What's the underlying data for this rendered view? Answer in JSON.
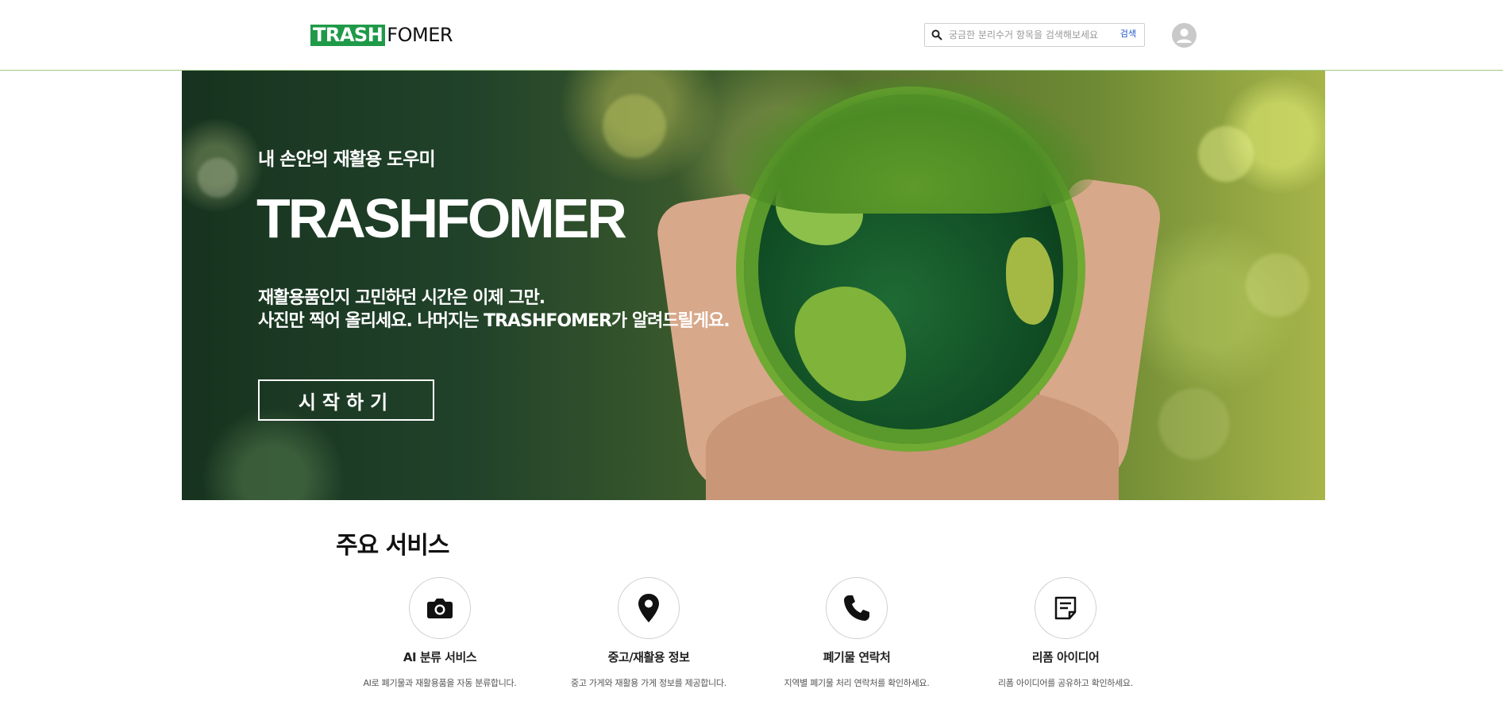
{
  "header": {
    "logo_trash": "TRASH",
    "logo_fomer": "FOMER",
    "search_placeholder": "궁금한 분리수거 항목을 검색해보세요",
    "search_button": "검색"
  },
  "hero": {
    "subtitle": "내 손안의 재활용 도우미",
    "title": "TRASHFOMER",
    "desc_line1": "재활용품인지 고민하던 시간은 이제 그만.",
    "desc_line2": "사진만 찍어 올리세요. 나머지는 TRASHFOMER가 알려드릴게요.",
    "cta": "시작하기"
  },
  "services": {
    "title": "주요 서비스",
    "items": [
      {
        "icon": "camera-icon",
        "name": "AI 분류 서비스",
        "desc": "AI로 폐기물과 재활용품을 자동 분류합니다."
      },
      {
        "icon": "location-pin-icon",
        "name": "중고/재활용 정보",
        "desc": "중고 가게와 재활용 가게 정보를 제공합니다."
      },
      {
        "icon": "phone-icon",
        "name": "폐기물 연락처",
        "desc": "지역별 폐기물 처리 연락처를 확인하세요."
      },
      {
        "icon": "note-icon",
        "name": "리폼 아이디어",
        "desc": "리폼 아이디어를 공유하고 확인하세요."
      }
    ]
  },
  "colors": {
    "brand_green": "#1f9a48",
    "search_button_blue": "#1a56c4",
    "header_border": "#9cc98a"
  }
}
